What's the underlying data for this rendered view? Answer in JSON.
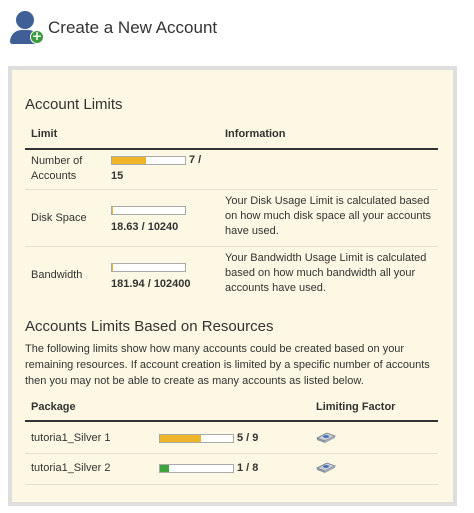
{
  "page": {
    "title": "Create a New Account"
  },
  "account_limits": {
    "heading": "Account Limits",
    "columns": {
      "limit": "Limit",
      "information": "Information"
    },
    "rows": [
      {
        "label": "Number of Accounts",
        "value_top": "7 /",
        "value_bottom": "15",
        "info": "",
        "fill_fraction": 0.4667,
        "fill_color": "#f0b429"
      },
      {
        "label": "Disk Space",
        "value": "18.63 / 10240",
        "info": "Your Disk Usage Limit is calculated based on how much disk space all your accounts have used.",
        "fill_fraction": 0.0018,
        "fill_color": "#f0b429"
      },
      {
        "label": "Bandwidth",
        "value": "181.94 / 102400",
        "info": "Your Bandwidth Usage Limit is calculated based on how much bandwidth all your accounts have used.",
        "fill_fraction": 0.0018,
        "fill_color": "#f0b429"
      }
    ]
  },
  "resources": {
    "heading": "Accounts Limits Based on Resources",
    "description": "The following limits show how many accounts could be created based on your remaining resources. If account creation is limited by a specific number of accounts then you may not be able to create as many accounts as listed below.",
    "columns": {
      "package": "Package",
      "limiting_factor": "Limiting Factor"
    },
    "rows": [
      {
        "package": "tutoria1_Silver 1",
        "value": "5 / 9",
        "fill_fraction": 0.5556,
        "fill_color": "#f0b429",
        "factor_icon": "disk-drive-icon"
      },
      {
        "package": "tutoria1_Silver 2",
        "value": "1 / 8",
        "fill_fraction": 0.125,
        "fill_color": "#3da33d",
        "factor_icon": "disk-drive-icon"
      }
    ]
  }
}
